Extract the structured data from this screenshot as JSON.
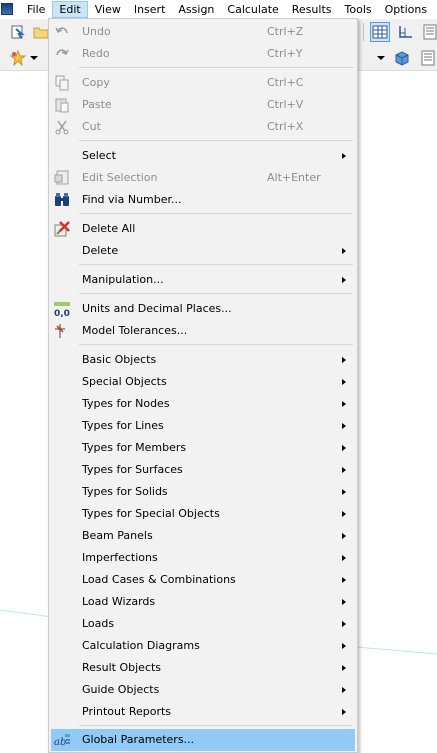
{
  "menubar": {
    "items": [
      {
        "label": "File"
      },
      {
        "label": "Edit"
      },
      {
        "label": "View"
      },
      {
        "label": "Insert"
      },
      {
        "label": "Assign"
      },
      {
        "label": "Calculate"
      },
      {
        "label": "Results"
      },
      {
        "label": "Tools"
      },
      {
        "label": "Options"
      }
    ],
    "active_item": "Edit"
  },
  "edit_menu": {
    "items": [
      {
        "label": "Undo",
        "shortcut": "Ctrl+Z",
        "enabled": false,
        "icon": "undo-icon"
      },
      {
        "label": "Redo",
        "shortcut": "Ctrl+Y",
        "enabled": false,
        "icon": "redo-icon"
      },
      {
        "label": "Copy",
        "shortcut": "Ctrl+C",
        "enabled": false,
        "icon": "copy-icon"
      },
      {
        "label": "Paste",
        "shortcut": "Ctrl+V",
        "enabled": false,
        "icon": "paste-icon"
      },
      {
        "label": "Cut",
        "shortcut": "Ctrl+X",
        "enabled": false,
        "icon": "cut-icon"
      },
      {
        "label": "Select",
        "submenu": true
      },
      {
        "label": "Edit Selection",
        "shortcut": "Alt+Enter",
        "enabled": false,
        "icon": "edit-selection-icon"
      },
      {
        "label": "Find via Number...",
        "icon": "binoculars-icon"
      },
      {
        "label": "Delete All",
        "icon": "delete-all-icon"
      },
      {
        "label": "Delete",
        "submenu": true
      },
      {
        "label": "Manipulation...",
        "submenu": true
      },
      {
        "label": "Units and Decimal Places...",
        "icon": "units-decimal-icon"
      },
      {
        "label": "Model Tolerances...",
        "icon": "tolerance-icon"
      },
      {
        "label": "Basic Objects",
        "submenu": true
      },
      {
        "label": "Special Objects",
        "submenu": true
      },
      {
        "label": "Types for Nodes",
        "submenu": true
      },
      {
        "label": "Types for Lines",
        "submenu": true
      },
      {
        "label": "Types for Members",
        "submenu": true
      },
      {
        "label": "Types for Surfaces",
        "submenu": true
      },
      {
        "label": "Types for Solids",
        "submenu": true
      },
      {
        "label": "Types for Special Objects",
        "submenu": true
      },
      {
        "label": "Beam Panels",
        "submenu": true
      },
      {
        "label": "Imperfections",
        "submenu": true
      },
      {
        "label": "Load Cases & Combinations",
        "submenu": true
      },
      {
        "label": "Load Wizards",
        "submenu": true
      },
      {
        "label": "Loads",
        "submenu": true
      },
      {
        "label": "Calculation Diagrams",
        "submenu": true
      },
      {
        "label": "Result Objects",
        "submenu": true
      },
      {
        "label": "Guide Objects",
        "submenu": true
      },
      {
        "label": "Printout Reports",
        "submenu": true
      },
      {
        "label": "Global Parameters...",
        "icon": "global-parameters-icon",
        "highlighted": true
      }
    ]
  },
  "toolbar_icons": [
    "import-icon",
    "open-folder-icon",
    "table-view-icon",
    "axis-icon",
    "panel-icon",
    "star-icon",
    "dropdown-arrow-icon",
    "dropdown-arrow-icon",
    "cube-icon",
    "panel-icon"
  ],
  "colors": {
    "menu_background": "#f2f2f2",
    "highlight": "#91c9f7",
    "active_menubar": "#cce4f7",
    "disabled_text": "#8d8d8d",
    "model_line": "#b8e6ee"
  }
}
